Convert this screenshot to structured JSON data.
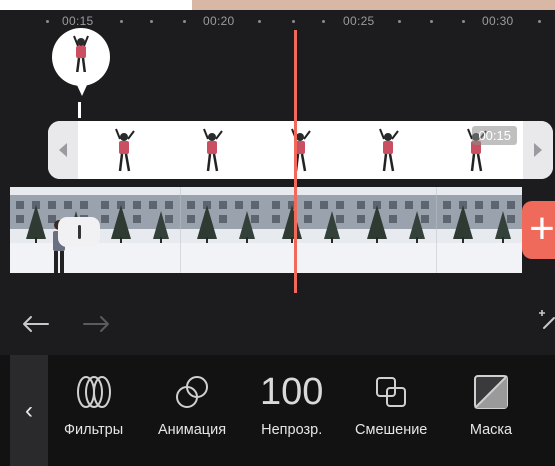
{
  "timeline": {
    "ruler_labels": [
      "00:15",
      "00:20",
      "00:25",
      "00:30"
    ]
  },
  "overlay_clip": {
    "duration": "00:15",
    "frame_count": 5
  },
  "video_clip": {
    "frame_count": 6
  },
  "add_button": {
    "label": "+"
  },
  "toolbar": {
    "back_label": "‹",
    "opacity_value": "100",
    "items": [
      {
        "label": "Фильтры",
        "icon": "filters-icon"
      },
      {
        "label": "Анимация",
        "icon": "animation-icon"
      },
      {
        "label": "Непрозр.",
        "icon": "opacity-value"
      },
      {
        "label": "Смешение",
        "icon": "blend-icon"
      },
      {
        "label": "Маска",
        "icon": "mask-icon"
      }
    ]
  },
  "colors": {
    "background": "#1c1c1e",
    "playhead": "#f06a5c",
    "accent": "#f06a5c",
    "toolbar_bg": "#121212"
  }
}
